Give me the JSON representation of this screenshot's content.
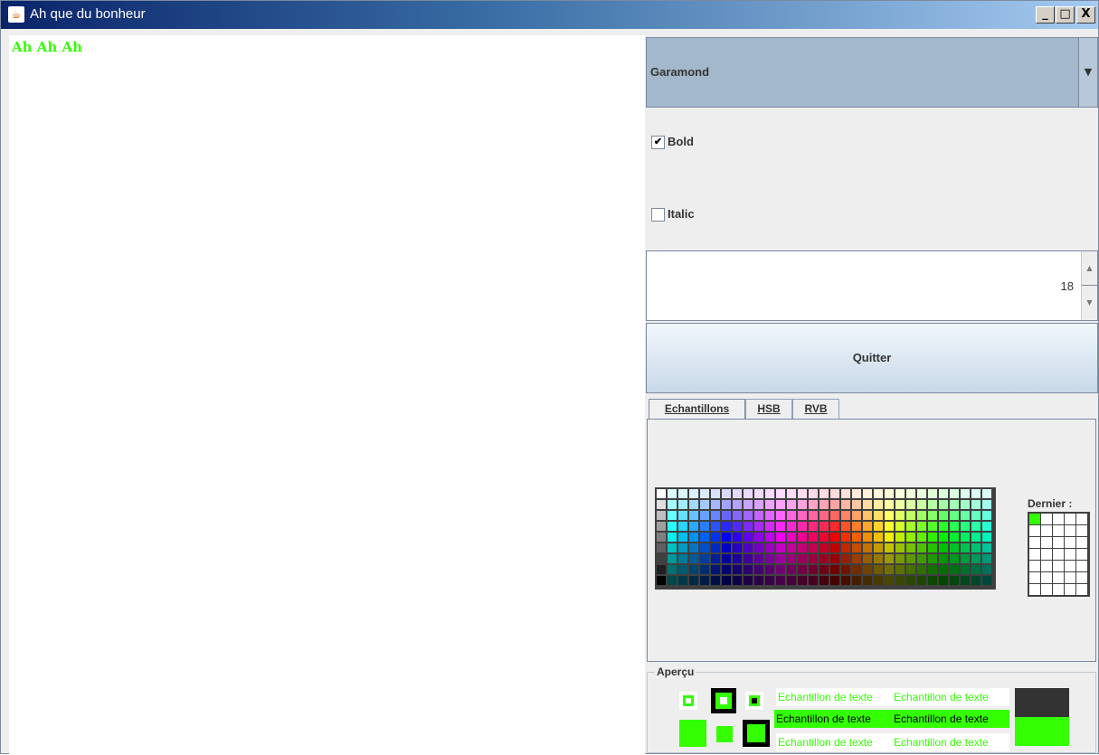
{
  "window": {
    "title": "Ah que du bonheur",
    "controls": {
      "minimize": "_",
      "maximize": "□",
      "close": "X"
    }
  },
  "preview": {
    "text": "Ah Ah Ah",
    "color": "#33ff00"
  },
  "font_combo": {
    "selected": "Garamond"
  },
  "bold": {
    "label": "Bold",
    "checked": true
  },
  "italic": {
    "label": "Italic",
    "checked": false
  },
  "size_spinner": {
    "value": "18"
  },
  "quit_button": {
    "label": "Quitter"
  },
  "color_chooser": {
    "tabs": [
      "Echantillons",
      "HSB",
      "RVB"
    ],
    "active_tab": "Echantillons",
    "recent_label": "Dernier :",
    "recent_color": "#33ff00",
    "preview_title": "Aperçu",
    "sample_text": "Echantillon de texte",
    "selected_color": "#33ff00",
    "dark_color": "#333333"
  }
}
